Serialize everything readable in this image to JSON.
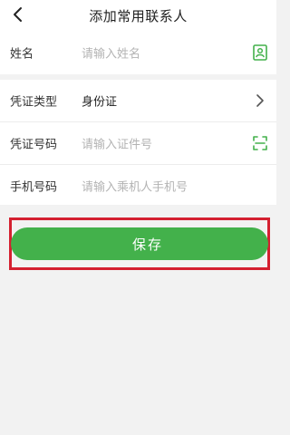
{
  "header": {
    "title": "添加常用联系人",
    "back_icon": "chevron-left-icon"
  },
  "form": {
    "name": {
      "label": "姓名",
      "placeholder": "请输入姓名",
      "icon": "contact-book-icon"
    },
    "id_type": {
      "label": "凭证类型",
      "value": "身份证",
      "icon": "chevron-right-icon"
    },
    "id_number": {
      "label": "凭证号码",
      "placeholder": "请输入证件号",
      "icon": "scan-icon"
    },
    "phone": {
      "label": "手机号码",
      "placeholder": "请输入乘机人手机号"
    }
  },
  "save_button": {
    "label": "保存"
  },
  "colors": {
    "accent": "#43b14b",
    "highlight": "#d42030",
    "background": "#f2f2f2"
  }
}
